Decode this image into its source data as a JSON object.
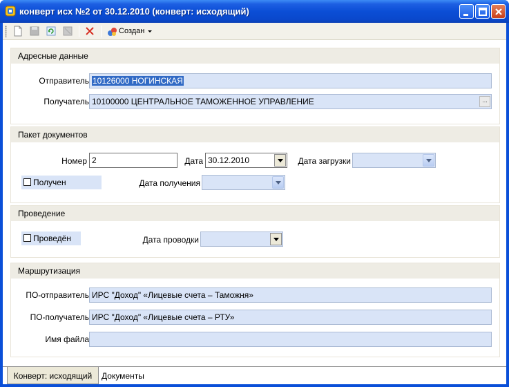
{
  "window": {
    "title": "конверт исх №2 от 30.12.2010 (конверт: исходящий)",
    "controls": {
      "minimize": "minimize-icon",
      "maximize": "maximize-icon",
      "close": "close-icon"
    }
  },
  "toolbar": {
    "tools": [
      "new-document-icon",
      "save-icon",
      "refresh-icon",
      "disabled-tool-icon",
      "delete-icon",
      "status-icon"
    ],
    "status_label": "Создан"
  },
  "address": {
    "title": "Адресные данные",
    "sender_label": "Отправитель",
    "sender_value": "10126000  НОГИНСКАЯ",
    "recipient_label": "Получатель",
    "recipient_value": "10100000  ЦЕНТРАЛЬНОЕ ТАМОЖЕННОЕ УПРАВЛЕНИЕ",
    "recipient_button": "..."
  },
  "package": {
    "title": "Пакет документов",
    "number_label": "Номер",
    "number_value": "2",
    "date_label": "Дата",
    "date_value": "30.12.2010",
    "load_date_label": "Дата загрузки",
    "load_date_value": "",
    "received_label": "Получен",
    "received_checked": false,
    "received_date_label": "Дата получения",
    "received_date_value": ""
  },
  "posting": {
    "title": "Проведение",
    "posted_label": "Проведён",
    "posted_checked": false,
    "posting_date_label": "Дата проводки",
    "posting_date_value": ""
  },
  "routing": {
    "title": "Маршрутизация",
    "from_label": "ПО-отправитель",
    "from_value": "ИРС \"Доход\" «Лицевые счета – Таможня»",
    "to_label": "ПО-получатель",
    "to_value": "ИРС \"Доход\" «Лицевые счета – РТУ»",
    "filename_label": "Имя файла",
    "filename_value": ""
  },
  "tabs": [
    {
      "label": "Конверт: исходящий",
      "active": true
    },
    {
      "label": "Документы",
      "active": false
    }
  ],
  "colors": {
    "field_bg": "#d9e4f7",
    "title_bar": "#0a4fd8",
    "group_header": "#eeece4",
    "selection": "#316ac5"
  }
}
